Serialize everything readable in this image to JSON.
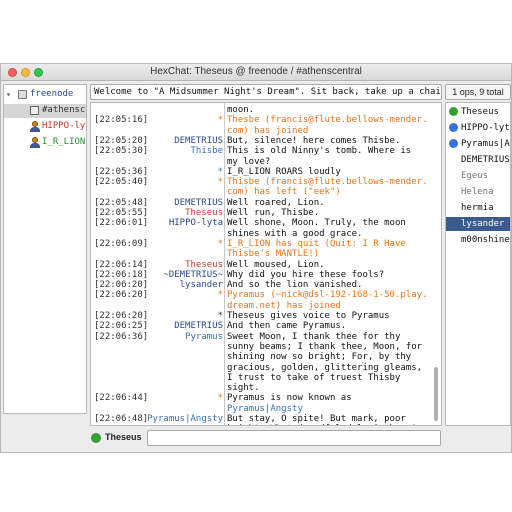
{
  "window": {
    "title": "HexChat: Theseus @ freenode / #athenscentral"
  },
  "sidebar": {
    "items": [
      {
        "label": "freenode",
        "color": "#2a4a8a",
        "kind": "server"
      },
      {
        "label": "#athensce",
        "color": "#333333",
        "kind": "channel",
        "selected": true
      },
      {
        "label": "HIPPO-lyt",
        "color": "#c0392b",
        "kind": "query"
      },
      {
        "label": "I_R_LION",
        "color": "#2e8b2e",
        "kind": "query"
      }
    ]
  },
  "topic": {
    "text": "Welcome to \"A Midsummer Night's Dream\". Sit back, take up a chair,"
  },
  "op_count": "1 ops, 9 total",
  "chat": {
    "lines": [
      {
        "ts": "",
        "nick": "",
        "msg": "moon.",
        "msg_color": "#111111"
      },
      {
        "ts": "[22:05:16]",
        "nick": "*",
        "nick_color": "#e8741a",
        "msg": "Thesbe (francis@flute.bellows-mender.",
        "msg_color": "#e8741a"
      },
      {
        "ts": "",
        "nick": "",
        "msg": "com) has joined",
        "msg_color": "#e8741a"
      },
      {
        "ts": "[22:05:20]",
        "nick": "DEMETRIUS",
        "nick_color": "#2a4a8a",
        "msg": "But, silence! here comes Thisbe.",
        "msg_color": "#111111"
      },
      {
        "ts": "[22:05:30]",
        "nick": "Thisbe",
        "nick_color": "#3a6fb5",
        "msg": "This is old Ninny's tomb. Where is",
        "msg_color": "#111111"
      },
      {
        "ts": "",
        "nick": "",
        "msg": "my love?",
        "msg_color": "#111111"
      },
      {
        "ts": "[22:05:36]",
        "nick": "*",
        "nick_color": "#3a6fb5",
        "msg": "I_R_LION ROARS loudly",
        "msg_color": "#111111"
      },
      {
        "ts": "[22:05:40]",
        "nick": "*",
        "nick_color": "#e8741a",
        "msg": "Thisbe (francis@flute.bellows-mender.",
        "msg_color": "#e8741a"
      },
      {
        "ts": "",
        "nick": "",
        "msg": "com) has left (\"eek\")",
        "msg_color": "#e8741a"
      },
      {
        "ts": "[22:05:48]",
        "nick": "DEMETRIUS",
        "nick_color": "#2a4a8a",
        "msg": "Well roared, Lion.",
        "msg_color": "#111111"
      },
      {
        "ts": "[22:05:55]",
        "nick": "Theseus",
        "nick_color": "#c0392b",
        "msg": "Well run, Thisbe.",
        "msg_color": "#111111"
      },
      {
        "ts": "[22:06:01]",
        "nick": "HIPPO-lyta",
        "nick_color": "#2a4a8a",
        "msg": "Well shone, Moon. Truly, the moon",
        "msg_color": "#111111"
      },
      {
        "ts": "",
        "nick": "",
        "msg": "shines with a good grace.",
        "msg_color": "#111111"
      },
      {
        "ts": "[22:06:09]",
        "nick": "*",
        "nick_color": "#e8741a",
        "msg": "I_R_LION has quit (Quit: I R Have",
        "msg_color": "#e8741a"
      },
      {
        "ts": "",
        "nick": "",
        "msg": "Thisbe's MANTLE!)",
        "msg_color": "#e8741a"
      },
      {
        "ts": "[22:06:14]",
        "nick": "Theseus",
        "nick_color": "#c0392b",
        "msg": "Well moused, Lion.",
        "msg_color": "#111111"
      },
      {
        "ts": "[22:06:18]",
        "nick": "~DEMETRIUS~",
        "nick_color": "#2a4a8a",
        "msg": "Why did you hire these fools?",
        "msg_color": "#111111"
      },
      {
        "ts": "[22:06:20]",
        "nick": "lysander",
        "nick_color": "#2a4a8a",
        "msg": "And so the lion vanished.",
        "msg_color": "#111111"
      },
      {
        "ts": "[22:06:20]",
        "nick": "*",
        "nick_color": "#e8741a",
        "msg": "Pyramus (~nick@dsl-192-168-1-50.play.",
        "msg_color": "#e8741a"
      },
      {
        "ts": "",
        "nick": "",
        "msg": "dream.net) has joined",
        "msg_color": "#e8741a"
      },
      {
        "ts": "[22:06:20]",
        "nick": "*",
        "nick_color": "#333333",
        "msg": "Theseus gives voice to Pyramus",
        "msg_color": "#111111"
      },
      {
        "ts": "[22:06:25]",
        "nick": "DEMETRIUS",
        "nick_color": "#2a4a8a",
        "msg": "And then came Pyramus.",
        "msg_color": "#111111"
      },
      {
        "ts": "[22:06:36]",
        "nick": "Pyramus",
        "nick_color": "#3a6fb5",
        "msg": "Sweet Moon, I thank thee for thy",
        "msg_color": "#111111"
      },
      {
        "ts": "",
        "nick": "",
        "msg": "sunny beams; I thank thee, Moon, for",
        "msg_color": "#111111"
      },
      {
        "ts": "",
        "nick": "",
        "msg": "shining now so bright; For, by thy",
        "msg_color": "#111111"
      },
      {
        "ts": "",
        "nick": "",
        "msg": "gracious, golden, glittering gleams,",
        "msg_color": "#111111"
      },
      {
        "ts": "",
        "nick": "",
        "msg": "I trust to take of truest Thisby",
        "msg_color": "#111111"
      },
      {
        "ts": "",
        "nick": "",
        "msg": "sight.",
        "msg_color": "#111111"
      },
      {
        "ts": "[22:06:44]",
        "nick": "*",
        "nick_color": "#e8741a",
        "msg": "Pyramus is now known as",
        "msg_color": "#111111"
      },
      {
        "ts": "",
        "nick": "",
        "msg": "Pyramus|Angsty",
        "msg_color": "#3a6fb5"
      },
      {
        "ts": "[22:06:48]",
        "nick": "Pyramus|Angsty",
        "nick_color": "#3a6fb5",
        "msg": "But stay, O spite! But mark, poor",
        "msg_color": "#111111"
      },
      {
        "ts": "",
        "nick": "",
        "msg": "knight, What dreadful dole is here!",
        "msg_color": "#111111"
      }
    ],
    "row_gap_after": [
      4,
      10,
      13,
      20,
      27
    ]
  },
  "users": {
    "items": [
      {
        "name": "Theseus",
        "dot": "#35a032",
        "color": "#111111"
      },
      {
        "name": "HIPPO-lyta",
        "dot": "#3a6fd8",
        "color": "#111111"
      },
      {
        "name": "Pyramus|Ar",
        "dot": "#3a6fd8",
        "color": "#111111"
      },
      {
        "name": "DEMETRIUS",
        "dot": "",
        "color": "#111111"
      },
      {
        "name": "Egeus",
        "dot": "",
        "color": "#777777"
      },
      {
        "name": "Helena",
        "dot": "",
        "color": "#777777"
      },
      {
        "name": "hermia",
        "dot": "",
        "color": "#111111"
      },
      {
        "name": "lysander",
        "dot": "",
        "color": "#ffffff",
        "selected": true
      },
      {
        "name": "m00nshine",
        "dot": "",
        "color": "#111111"
      }
    ]
  },
  "input": {
    "nick": "Theseus",
    "value": ""
  }
}
